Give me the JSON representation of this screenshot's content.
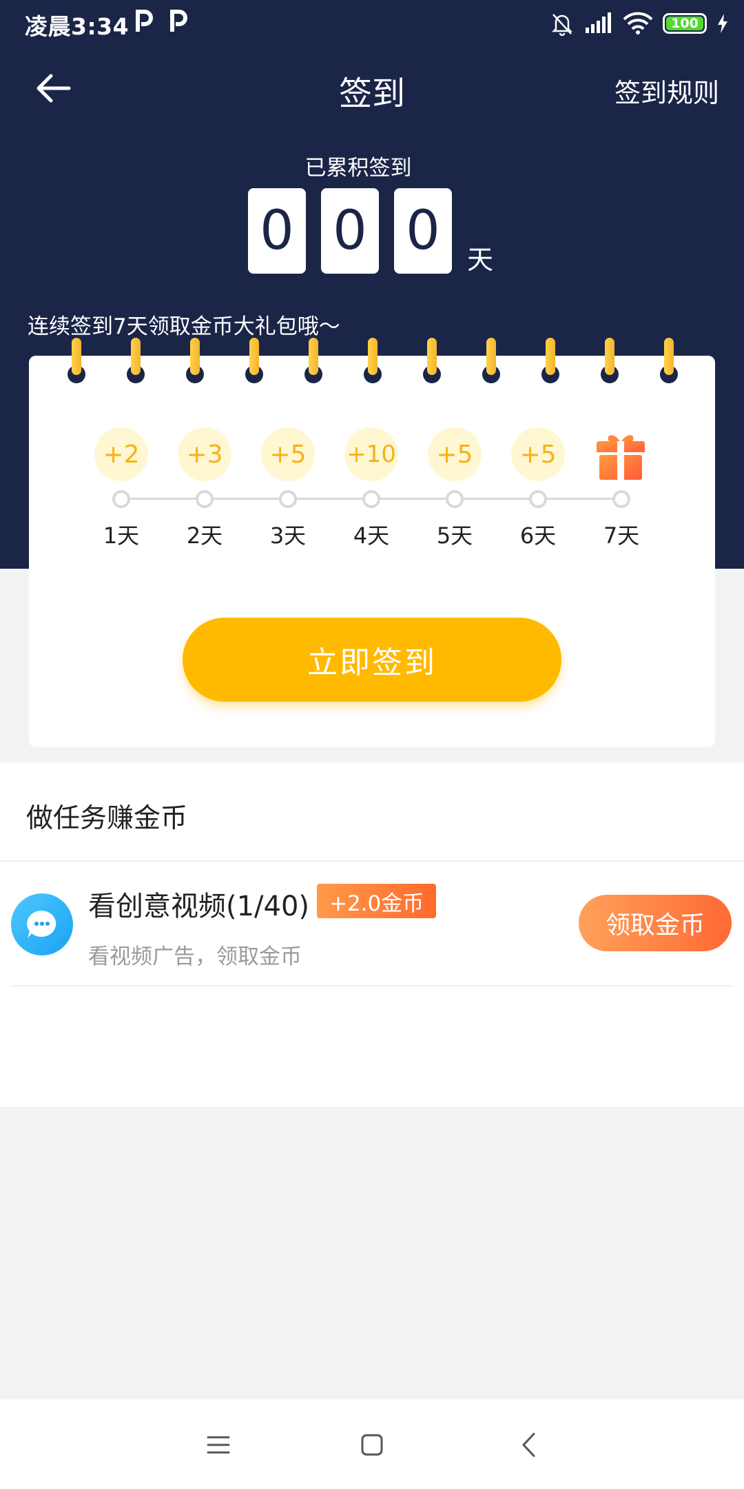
{
  "status_bar": {
    "time": "凌晨3:34",
    "battery": "100"
  },
  "nav": {
    "title": "签到",
    "rules": "签到规则"
  },
  "accumulated": {
    "label": "已累积签到",
    "digits": [
      "0",
      "0",
      "0"
    ],
    "unit": "天"
  },
  "promo": "连续签到7天领取金币大礼包哦～",
  "calendar": {
    "rewards": [
      "+2",
      "+3",
      "+5",
      "+10",
      "+5",
      "+5"
    ],
    "days": [
      "1天",
      "2天",
      "3天",
      "4天",
      "5天",
      "6天",
      "7天"
    ],
    "signin_button": "立即签到"
  },
  "tasks": {
    "title": "做任务赚金币",
    "items": [
      {
        "title": "看创意视频(1/40)",
        "badge": "+2.0金币",
        "subtitle": "看视频广告，领取金币",
        "button": "领取金币"
      }
    ]
  },
  "colors": {
    "header": "#1b2548",
    "accent": "#ffba00",
    "task_button": "#ff7a3d"
  }
}
